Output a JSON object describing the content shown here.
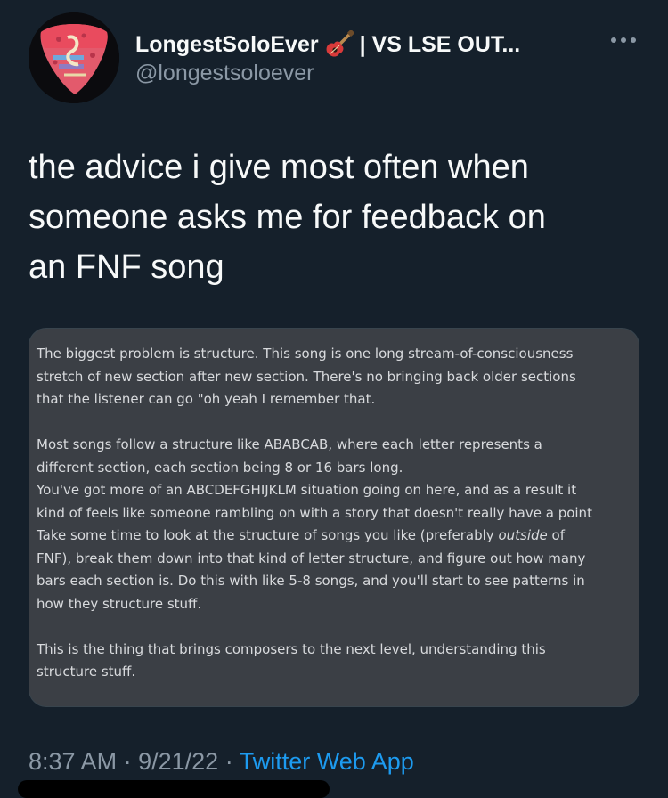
{
  "tweet": {
    "author": {
      "display_name": "LongestSoloEver",
      "name_emoji": "guitar-icon",
      "name_suffix": "| VS LSE OUT...",
      "handle": "@longestsoloever"
    },
    "text_lines": [
      "the advice i give most often when",
      "someone asks me for feedback on",
      "an FNF song"
    ],
    "image_text": {
      "para1": [
        "The biggest problem is structure. This song is one long stream-of-consciousness",
        "stretch of new section after new section. There's no bringing back older sections",
        "that the listener can go \"oh yeah I remember that."
      ],
      "para2": [
        "Most songs follow a structure like ABABCAB, where each letter represents a",
        "different section, each section being 8 or 16 bars long.",
        "You've got more of an ABCDEFGHIJKLM situation going on here, and as a result it",
        "kind of feels like someone rambling on with a story that doesn't really have a point"
      ],
      "para3": [
        "Take some time to look at the structure of songs you like (preferably ",
        "outside",
        " of",
        "FNF), break them down into that kind of letter structure, and figure out how many",
        "bars each section is. Do this with like 5-8 songs, and you'll start to see patterns in",
        "how they structure stuff."
      ],
      "para4": [
        "This is the thing that brings composers to the next level, understanding this",
        "structure stuff."
      ]
    },
    "time": "8:37 AM",
    "separator": "·",
    "date": "9/21/22",
    "source": "Twitter Web App"
  },
  "colors": {
    "background": "#15202b",
    "primary_text": "#f7f9f9",
    "secondary_text": "#8b98a5",
    "link": "#1d9bf0",
    "image_bg": "#3b3f45"
  }
}
